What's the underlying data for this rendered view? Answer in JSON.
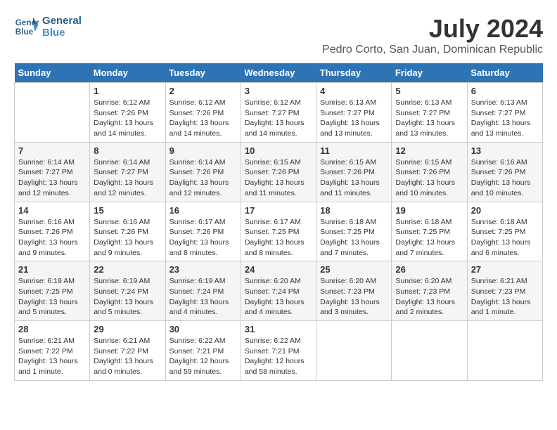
{
  "header": {
    "logo_line1": "General",
    "logo_line2": "Blue",
    "month": "July 2024",
    "location": "Pedro Corto, San Juan, Dominican Republic"
  },
  "weekdays": [
    "Sunday",
    "Monday",
    "Tuesday",
    "Wednesday",
    "Thursday",
    "Friday",
    "Saturday"
  ],
  "weeks": [
    [
      {
        "day": "",
        "info": ""
      },
      {
        "day": "1",
        "info": "Sunrise: 6:12 AM\nSunset: 7:26 PM\nDaylight: 13 hours\nand 14 minutes."
      },
      {
        "day": "2",
        "info": "Sunrise: 6:12 AM\nSunset: 7:26 PM\nDaylight: 13 hours\nand 14 minutes."
      },
      {
        "day": "3",
        "info": "Sunrise: 6:12 AM\nSunset: 7:27 PM\nDaylight: 13 hours\nand 14 minutes."
      },
      {
        "day": "4",
        "info": "Sunrise: 6:13 AM\nSunset: 7:27 PM\nDaylight: 13 hours\nand 13 minutes."
      },
      {
        "day": "5",
        "info": "Sunrise: 6:13 AM\nSunset: 7:27 PM\nDaylight: 13 hours\nand 13 minutes."
      },
      {
        "day": "6",
        "info": "Sunrise: 6:13 AM\nSunset: 7:27 PM\nDaylight: 13 hours\nand 13 minutes."
      }
    ],
    [
      {
        "day": "7",
        "info": "Sunrise: 6:14 AM\nSunset: 7:27 PM\nDaylight: 13 hours\nand 12 minutes."
      },
      {
        "day": "8",
        "info": "Sunrise: 6:14 AM\nSunset: 7:27 PM\nDaylight: 13 hours\nand 12 minutes."
      },
      {
        "day": "9",
        "info": "Sunrise: 6:14 AM\nSunset: 7:26 PM\nDaylight: 13 hours\nand 12 minutes."
      },
      {
        "day": "10",
        "info": "Sunrise: 6:15 AM\nSunset: 7:26 PM\nDaylight: 13 hours\nand 11 minutes."
      },
      {
        "day": "11",
        "info": "Sunrise: 6:15 AM\nSunset: 7:26 PM\nDaylight: 13 hours\nand 11 minutes."
      },
      {
        "day": "12",
        "info": "Sunrise: 6:15 AM\nSunset: 7:26 PM\nDaylight: 13 hours\nand 10 minutes."
      },
      {
        "day": "13",
        "info": "Sunrise: 6:16 AM\nSunset: 7:26 PM\nDaylight: 13 hours\nand 10 minutes."
      }
    ],
    [
      {
        "day": "14",
        "info": "Sunrise: 6:16 AM\nSunset: 7:26 PM\nDaylight: 13 hours\nand 9 minutes."
      },
      {
        "day": "15",
        "info": "Sunrise: 6:16 AM\nSunset: 7:26 PM\nDaylight: 13 hours\nand 9 minutes."
      },
      {
        "day": "16",
        "info": "Sunrise: 6:17 AM\nSunset: 7:26 PM\nDaylight: 13 hours\nand 8 minutes."
      },
      {
        "day": "17",
        "info": "Sunrise: 6:17 AM\nSunset: 7:25 PM\nDaylight: 13 hours\nand 8 minutes."
      },
      {
        "day": "18",
        "info": "Sunrise: 6:18 AM\nSunset: 7:25 PM\nDaylight: 13 hours\nand 7 minutes."
      },
      {
        "day": "19",
        "info": "Sunrise: 6:18 AM\nSunset: 7:25 PM\nDaylight: 13 hours\nand 7 minutes."
      },
      {
        "day": "20",
        "info": "Sunrise: 6:18 AM\nSunset: 7:25 PM\nDaylight: 13 hours\nand 6 minutes."
      }
    ],
    [
      {
        "day": "21",
        "info": "Sunrise: 6:19 AM\nSunset: 7:25 PM\nDaylight: 13 hours\nand 5 minutes."
      },
      {
        "day": "22",
        "info": "Sunrise: 6:19 AM\nSunset: 7:24 PM\nDaylight: 13 hours\nand 5 minutes."
      },
      {
        "day": "23",
        "info": "Sunrise: 6:19 AM\nSunset: 7:24 PM\nDaylight: 13 hours\nand 4 minutes."
      },
      {
        "day": "24",
        "info": "Sunrise: 6:20 AM\nSunset: 7:24 PM\nDaylight: 13 hours\nand 4 minutes."
      },
      {
        "day": "25",
        "info": "Sunrise: 6:20 AM\nSunset: 7:23 PM\nDaylight: 13 hours\nand 3 minutes."
      },
      {
        "day": "26",
        "info": "Sunrise: 6:20 AM\nSunset: 7:23 PM\nDaylight: 13 hours\nand 2 minutes."
      },
      {
        "day": "27",
        "info": "Sunrise: 6:21 AM\nSunset: 7:23 PM\nDaylight: 13 hours\nand 1 minute."
      }
    ],
    [
      {
        "day": "28",
        "info": "Sunrise: 6:21 AM\nSunset: 7:22 PM\nDaylight: 13 hours\nand 1 minute."
      },
      {
        "day": "29",
        "info": "Sunrise: 6:21 AM\nSunset: 7:22 PM\nDaylight: 13 hours\nand 0 minutes."
      },
      {
        "day": "30",
        "info": "Sunrise: 6:22 AM\nSunset: 7:21 PM\nDaylight: 12 hours\nand 59 minutes."
      },
      {
        "day": "31",
        "info": "Sunrise: 6:22 AM\nSunset: 7:21 PM\nDaylight: 12 hours\nand 58 minutes."
      },
      {
        "day": "",
        "info": ""
      },
      {
        "day": "",
        "info": ""
      },
      {
        "day": "",
        "info": ""
      }
    ]
  ]
}
